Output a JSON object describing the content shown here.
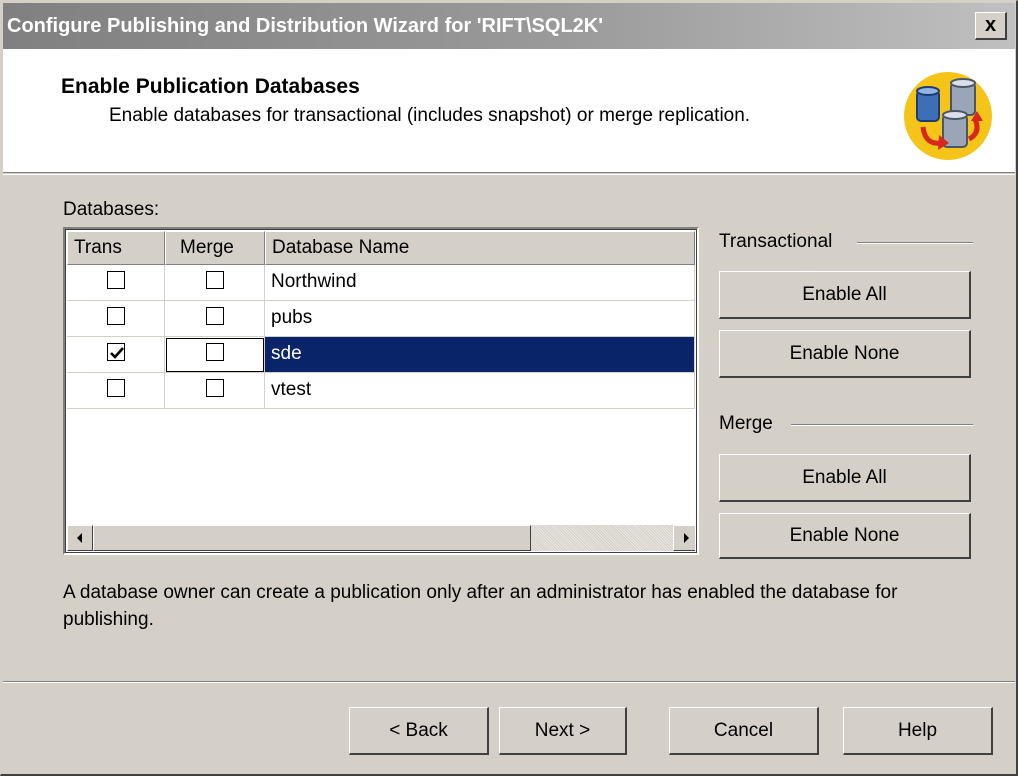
{
  "window": {
    "title": "Configure Publishing and Distribution Wizard for 'RIFT\\SQL2K'",
    "close_label": "x"
  },
  "header": {
    "title": "Enable Publication Databases",
    "subtitle": "Enable databases for transactional (includes snapshot) or merge replication.",
    "icon": "database-replication-icon"
  },
  "databases": {
    "label": "Databases:",
    "columns": [
      "Trans",
      "Merge",
      "Database Name"
    ],
    "rows": [
      {
        "name": "Northwind",
        "trans": false,
        "merge": false
      },
      {
        "name": "pubs",
        "trans": false,
        "merge": false
      },
      {
        "name": "sde",
        "trans": true,
        "merge": false
      },
      {
        "name": "vtest",
        "trans": false,
        "merge": false
      }
    ],
    "selected_row": 2
  },
  "transactional": {
    "label": "Transactional",
    "enable_all": "Enable All",
    "enable_none": "Enable None"
  },
  "merge": {
    "label": "Merge",
    "enable_all": "Enable All",
    "enable_none": "Enable None"
  },
  "footer": {
    "note": "A database owner can create a publication only after an administrator has enabled the database for publishing."
  },
  "buttons": {
    "back": "< Back",
    "next": "Next >",
    "cancel": "Cancel",
    "help": "Help"
  },
  "colors": {
    "selection": "#0a246a",
    "face": "#d4d0c8",
    "icon_circle": "#f4c418"
  }
}
